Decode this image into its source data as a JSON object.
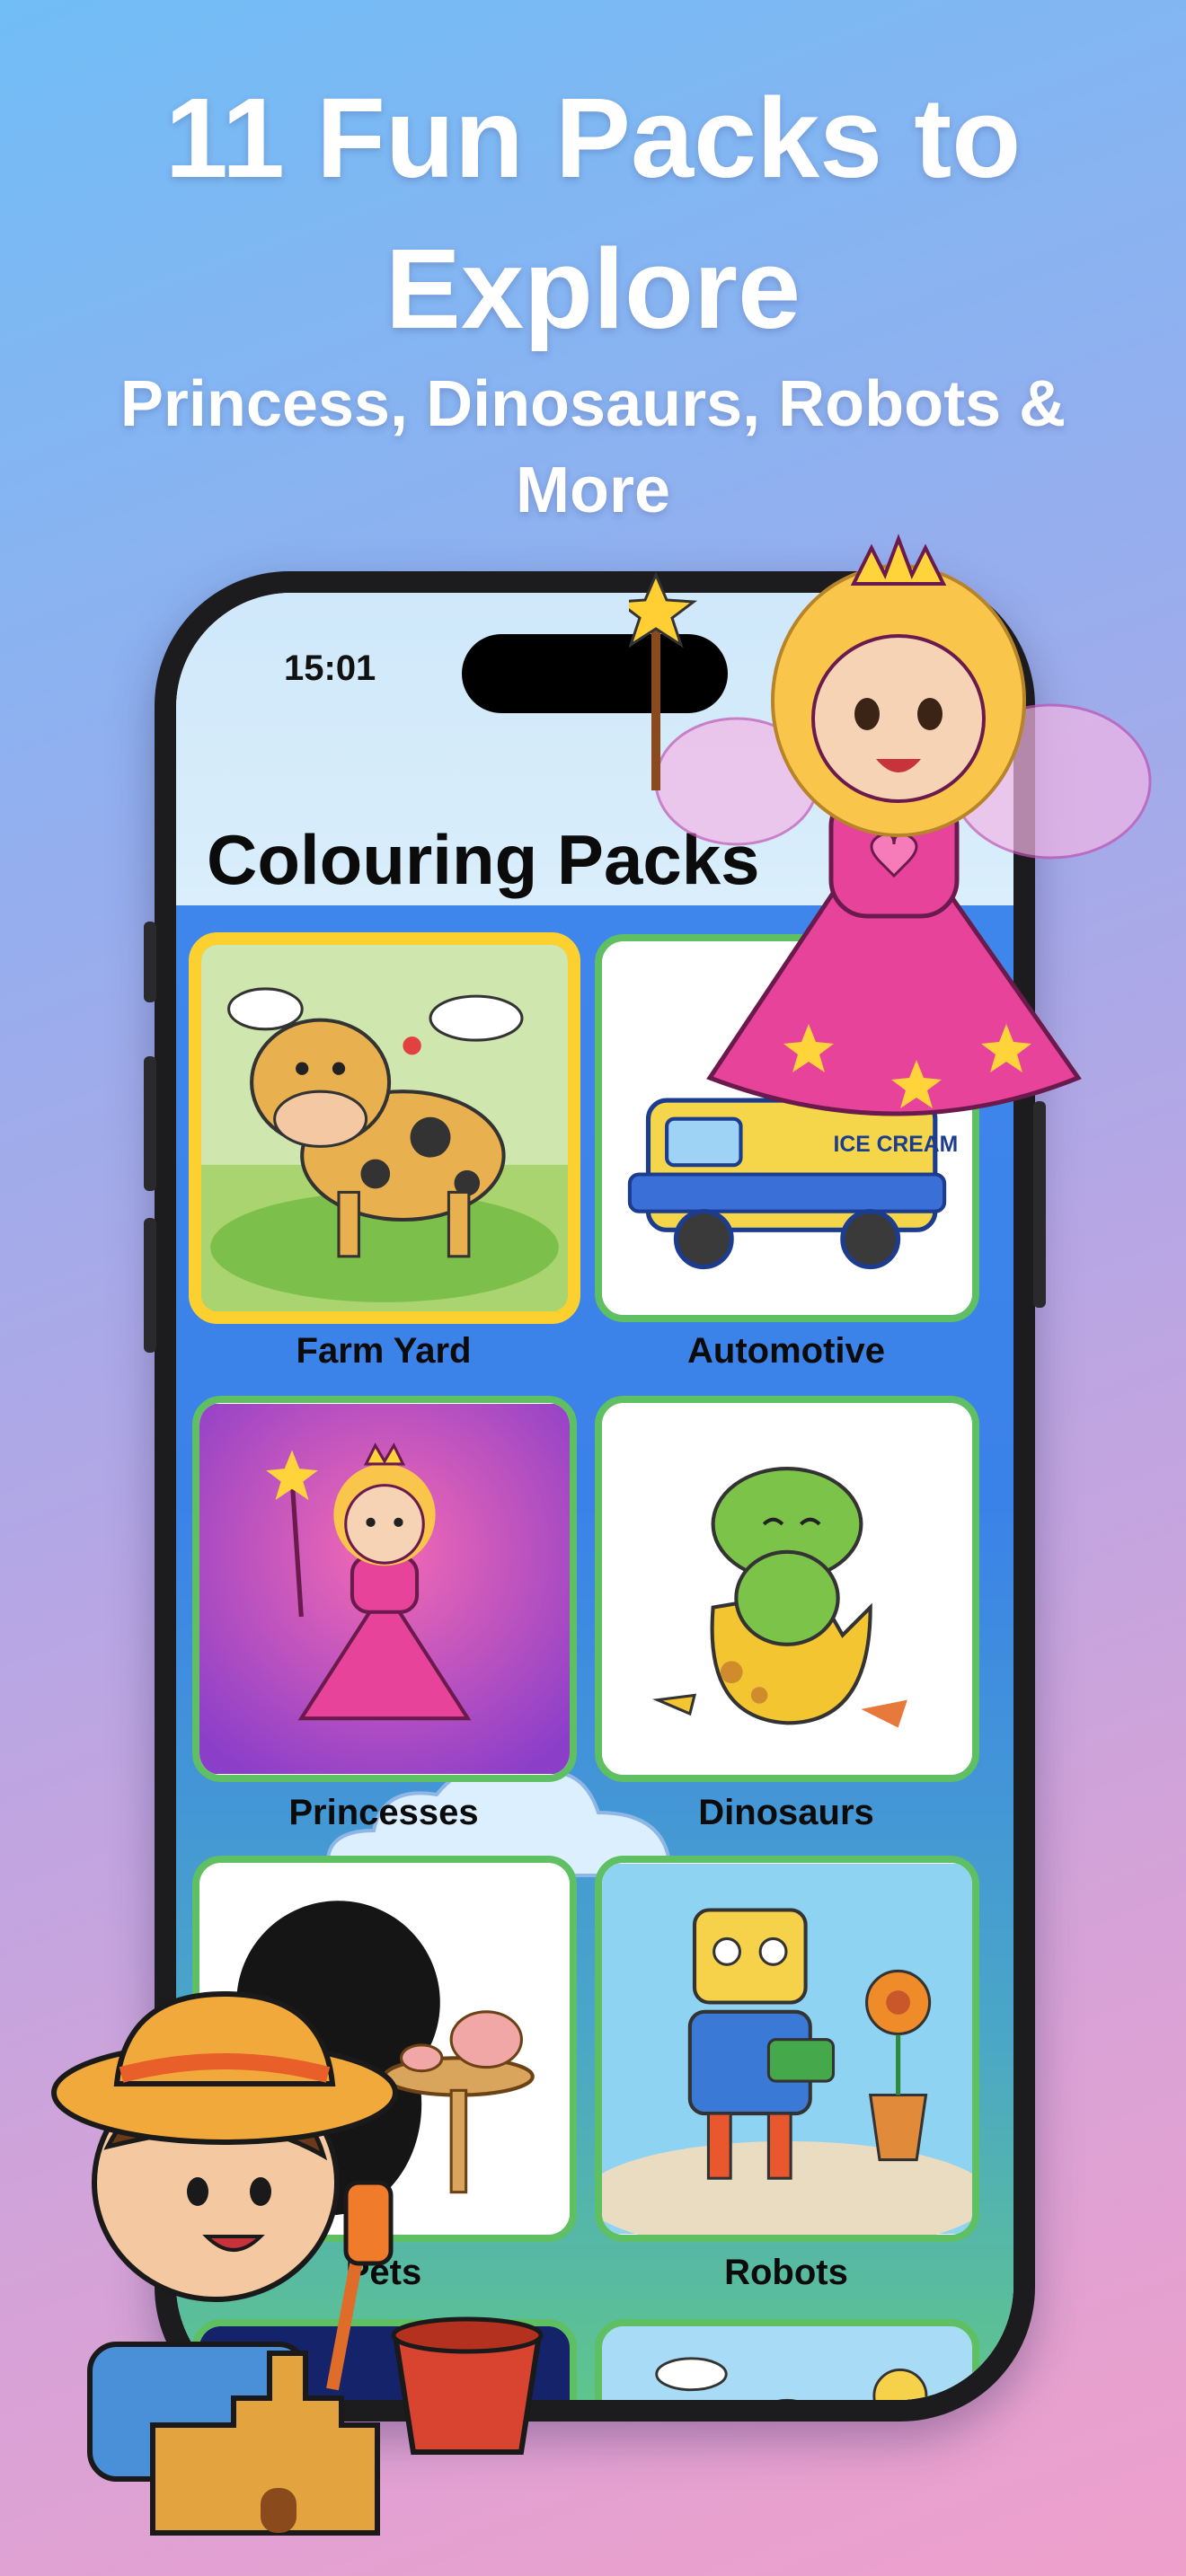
{
  "promo": {
    "headline": "11 Fun Packs to Explore",
    "subheadline": "Princess, Dinosaurs, Robots & More"
  },
  "status_bar": {
    "time": "15:01"
  },
  "screen": {
    "title": "Colouring Packs"
  },
  "packs": [
    {
      "label": "Farm Yard",
      "selected": true
    },
    {
      "label": "Automotive",
      "selected": false,
      "image_text": "ICE CREAM"
    },
    {
      "label": "Princesses",
      "selected": false
    },
    {
      "label": "Dinosaurs",
      "selected": false
    },
    {
      "label": "Pets",
      "selected": false
    },
    {
      "label": "Robots",
      "selected": false
    }
  ],
  "colors": {
    "card_border": "#5fbf63",
    "selected_border": "#fcd12f",
    "content_gradient_top": "#3f86ec",
    "content_gradient_bottom": "#5fc58c"
  }
}
